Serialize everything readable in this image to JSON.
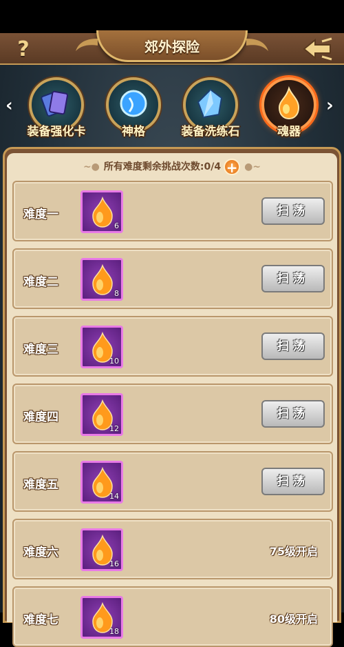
{
  "header": {
    "title": "郊外探险",
    "help_label": "?"
  },
  "categories": [
    {
      "label": "装备强化卡",
      "icon": "card-stack-icon",
      "active": false
    },
    {
      "label": "神格",
      "icon": "blue-orb-icon",
      "active": false
    },
    {
      "label": "装备洗练石",
      "icon": "crystal-icon",
      "active": false
    },
    {
      "label": "魂器",
      "icon": "soul-flame-icon",
      "active": true
    }
  ],
  "nav": {
    "prev_arrow": "‹",
    "next_arrow": "›"
  },
  "remaining": {
    "text": "所有难度剩余挑战次数:0/4",
    "add_label": "+"
  },
  "rows": [
    {
      "name": "难度一",
      "qty": "6",
      "action": "扫荡"
    },
    {
      "name": "难度二",
      "qty": "8",
      "action": "扫荡"
    },
    {
      "name": "难度三",
      "qty": "10",
      "action": "扫荡"
    },
    {
      "name": "难度四",
      "qty": "12",
      "action": "扫荡"
    },
    {
      "name": "难度五",
      "qty": "14",
      "action": "扫荡"
    },
    {
      "name": "难度六",
      "qty": "16",
      "lock": "75级开启"
    },
    {
      "name": "难度七",
      "qty": "18",
      "lock": "80级开启"
    }
  ],
  "colors": {
    "accent": "#ff7a22",
    "panel": "#eee0c4",
    "item_border": "#e87ae6"
  }
}
